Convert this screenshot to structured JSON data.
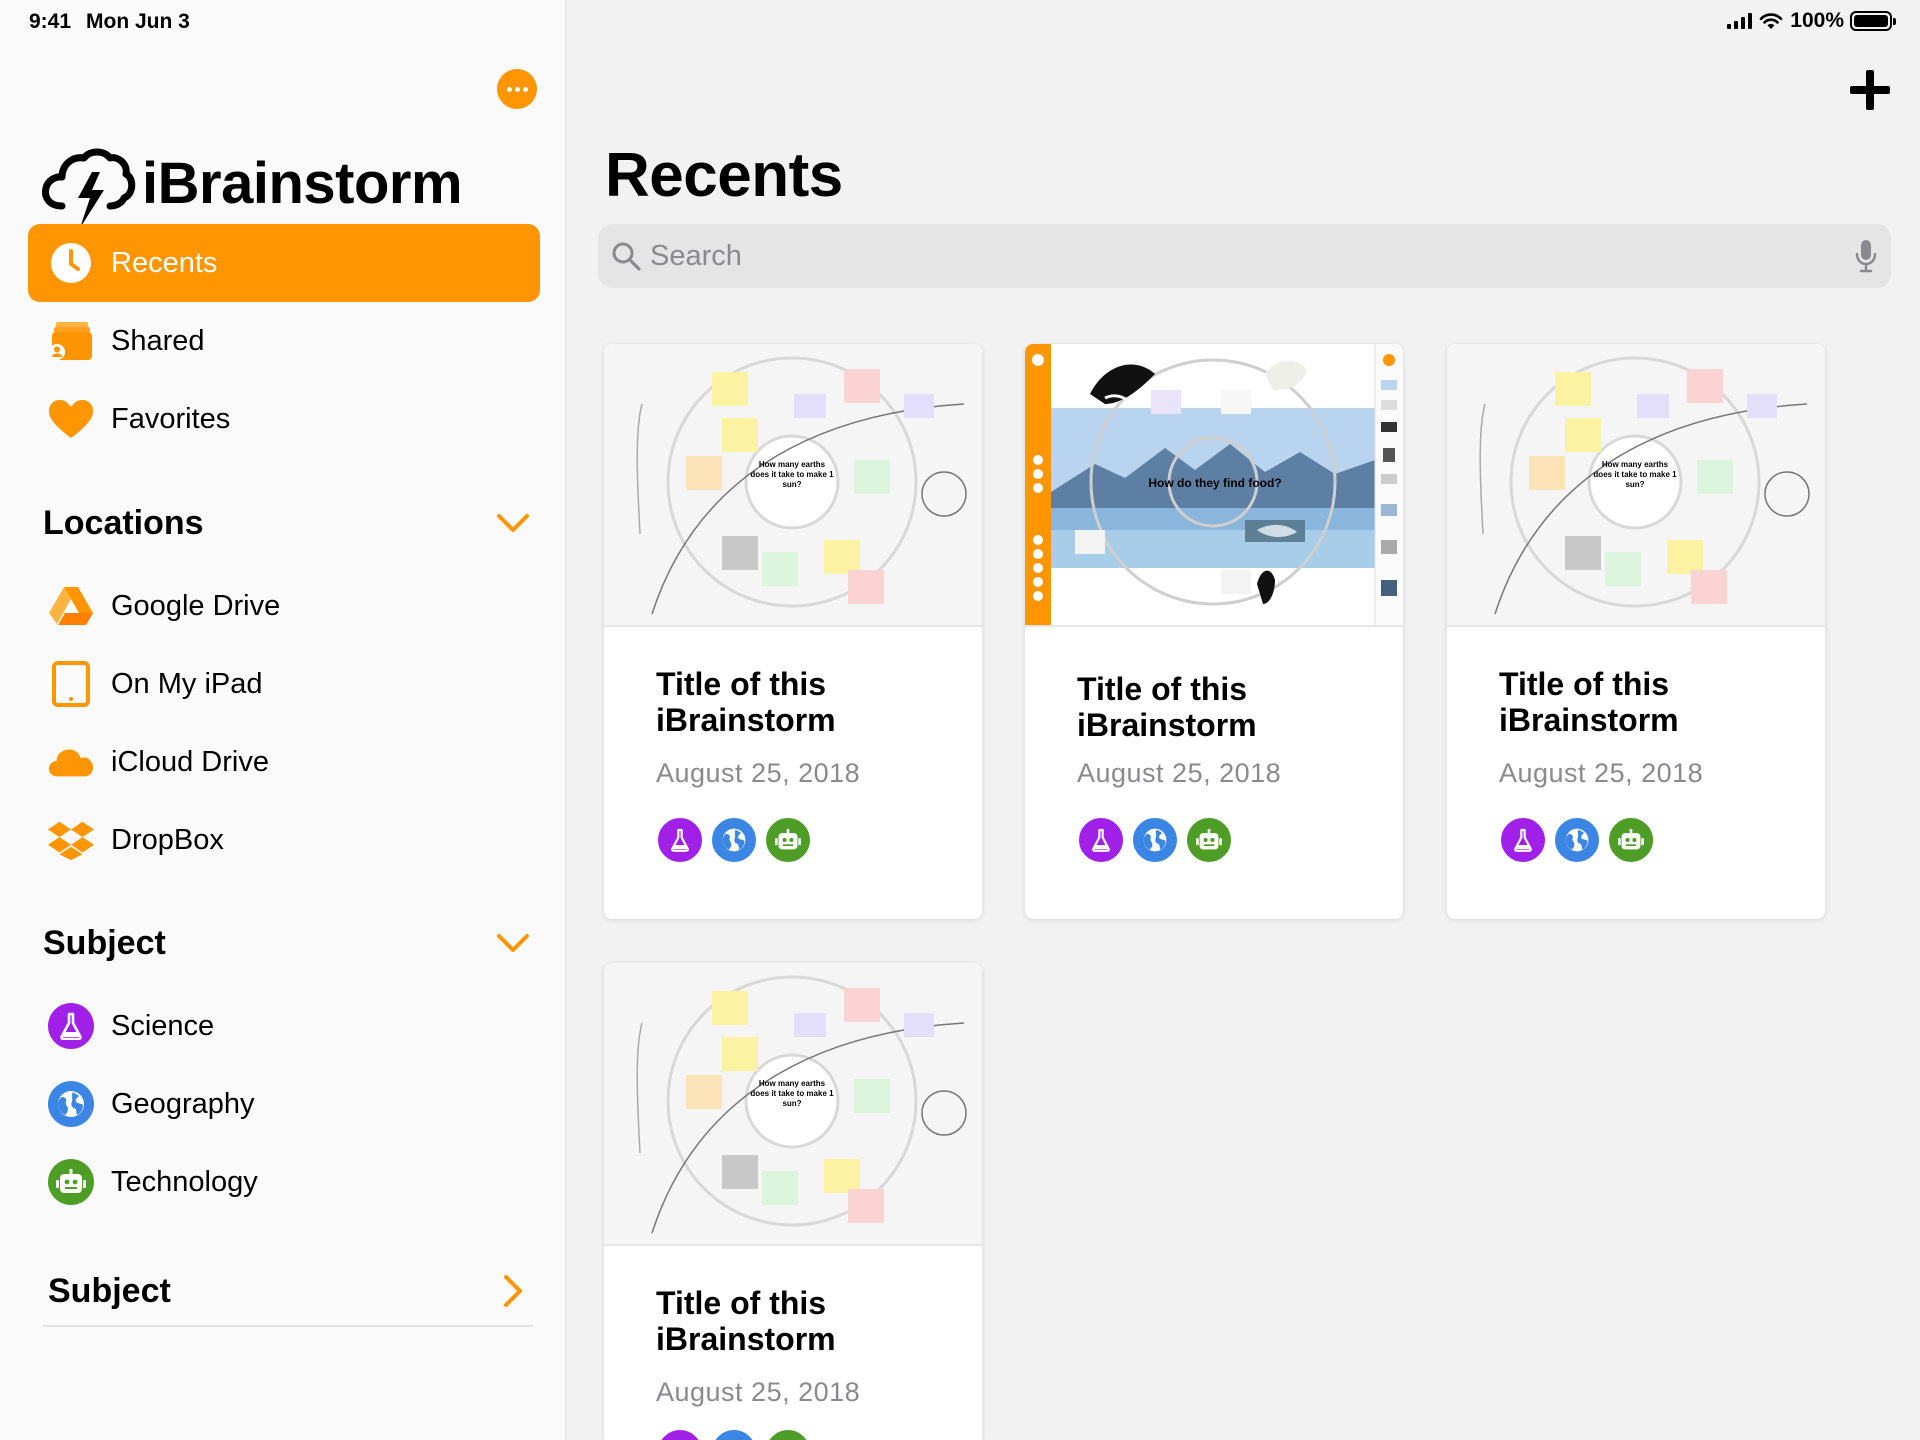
{
  "status_bar": {
    "time": "9:41",
    "date": "Mon Jun 3",
    "battery": "100%"
  },
  "app": {
    "name": "iBrainstorm"
  },
  "sidebar": {
    "nav": [
      {
        "label": "Recents",
        "icon": "clock-icon",
        "active": true
      },
      {
        "label": "Shared",
        "icon": "shared-folder-icon",
        "active": false
      },
      {
        "label": "Favorites",
        "icon": "heart-icon",
        "active": false
      }
    ],
    "locations": {
      "title": "Locations",
      "items": [
        {
          "label": "Google Drive",
          "icon": "google-drive-icon"
        },
        {
          "label": "On My iPad",
          "icon": "ipad-icon"
        },
        {
          "label": "iCloud Drive",
          "icon": "icloud-icon"
        },
        {
          "label": "DropBox",
          "icon": "dropbox-icon"
        }
      ]
    },
    "subject": {
      "title": "Subject",
      "items": [
        {
          "label": "Science",
          "icon": "flask-icon",
          "color": "#a020e8"
        },
        {
          "label": "Geography",
          "icon": "globe-icon",
          "color": "#3b86e4"
        },
        {
          "label": "Technology",
          "icon": "robot-icon",
          "color": "#4e9d26"
        }
      ]
    },
    "subject_collapsed": {
      "title": "Subject"
    }
  },
  "main": {
    "title": "Recents",
    "search_placeholder": "Search",
    "cards": [
      {
        "title": "Title of this iBrainstorm",
        "date": "August 25, 2018",
        "thumb": "whiteboard",
        "thumb_text": "How many earths does it take to make 1 sun?"
      },
      {
        "title": "Title of this iBrainstorm",
        "date": "August 25, 2018",
        "thumb": "arctic",
        "thumb_text": "How do they find food?"
      },
      {
        "title": "Title of this iBrainstorm",
        "date": "August 25, 2018",
        "thumb": "whiteboard",
        "thumb_text": "How many earths does it take to make 1 sun?"
      },
      {
        "title": "Title of this iBrainstorm",
        "date": "August 25, 2018",
        "thumb": "whiteboard",
        "thumb_text": "How many earths does it take to make 1 sun?"
      }
    ]
  },
  "colors": {
    "accent": "#ff9500",
    "science": "#a020e8",
    "geography": "#3b86e4",
    "technology": "#4e9d26"
  }
}
